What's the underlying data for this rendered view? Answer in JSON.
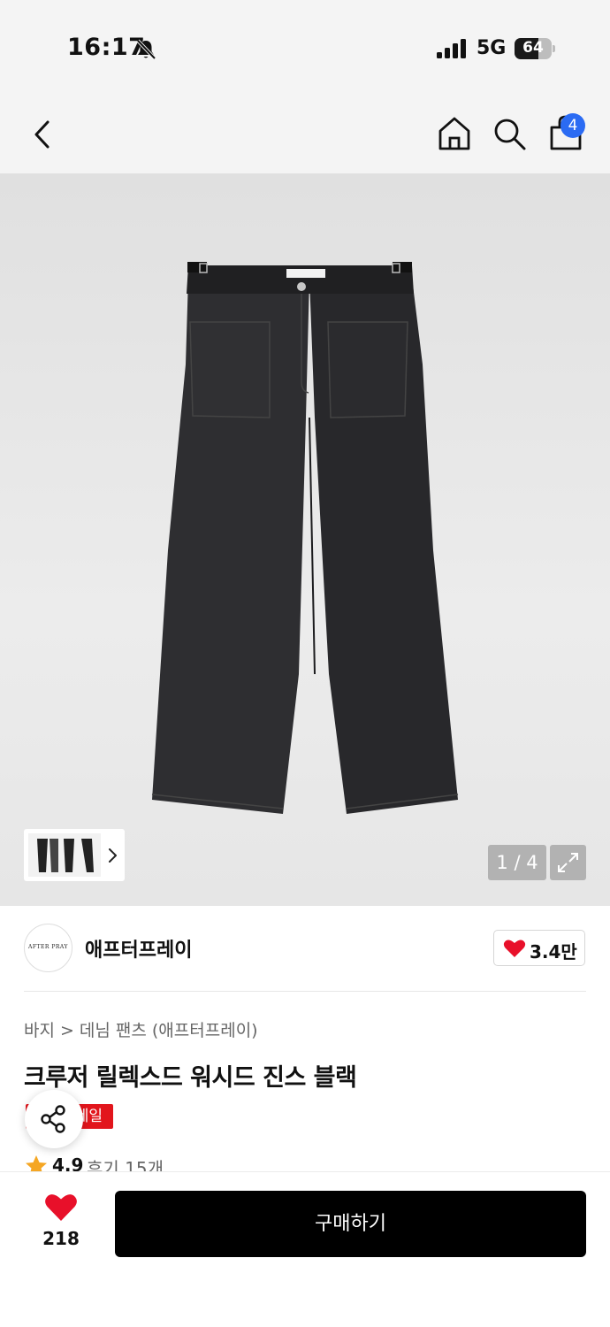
{
  "status_bar": {
    "time": "16:17",
    "network": "5G",
    "battery_level": "64",
    "battery_fraction": 0.64,
    "icons": [
      "bell-off-icon",
      "signal-icon",
      "battery-icon"
    ]
  },
  "nav": {
    "cart_count": "4",
    "icons": [
      "chevron-left-icon",
      "home-icon",
      "search-icon",
      "shopping-bag-icon"
    ]
  },
  "gallery": {
    "counter": "1 / 4",
    "current_index": 1,
    "total": 4
  },
  "brand": {
    "logo_text": "AFTER PRAY",
    "name": "애프터프레이",
    "likes": "3.4만"
  },
  "product": {
    "breadcrumb": [
      "바지",
      "데님 팬츠 (애프터프레이)"
    ],
    "title": "크루저 릴렉스드 워시드 진스 블랙",
    "badge": "세일",
    "rating": "4.9",
    "reviews": "후기 15개"
  },
  "actions": {
    "wish_count": "218",
    "buy_label": "구매하기"
  },
  "colors": {
    "accent_blue": "#2b6bf3",
    "sale_red": "#e2151c",
    "heart_red": "#e8102a",
    "star_orange": "#f5a623",
    "buy_black": "#000000"
  }
}
